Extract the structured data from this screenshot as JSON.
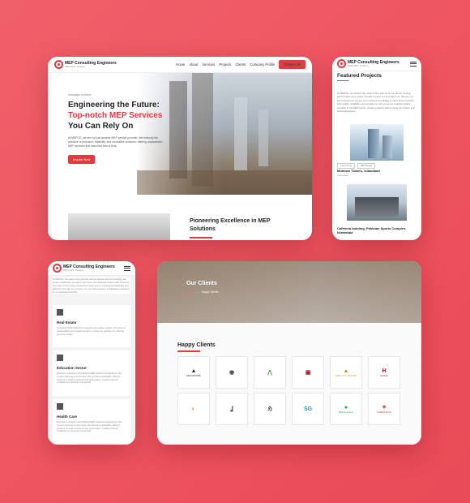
{
  "brand": {
    "name": "MEP Consulting Engineers",
    "tagline": "SMC-PVT. Limited",
    "accent": "#e53940"
  },
  "desktop": {
    "nav": [
      "Home",
      "About",
      "Services",
      "Projects",
      "Clients",
      "Company Profile"
    ],
    "cta": "Contact Us",
    "hero": {
      "kicker": "Innovation in Action",
      "h1_line1": "Engineering the Future:",
      "h1_line2": "Top-notch MEP Services",
      "h1_line3": "You Can Rely On",
      "body": "At MEPCE, we are not just another MEP service provider. We embody the pinnacle of precision, reliability, and innovative solutions; offering unparalleled MEP services that stand the test of time.",
      "button": "Inquire Now"
    },
    "section2_title": "Pioneering Excellence in MEP Solutions"
  },
  "featured": {
    "title": "Featured Projects",
    "body": "At MEPCE, we cherish the dreams and visions of our clients, finding each project as a unique canvas to paint our innovation on. We are not just contractors; we are your partners in building a future that resonates with quality, reliability, and excellence. Join us as we redefine what's possible in the MEP sector, creating spaces that embody innovation and technical finesse.",
    "tags": [
      "Commercial",
      "MEP Design"
    ],
    "projects": [
      {
        "name": "Midtown Towers, Islamabad",
        "sub": "Islamabad"
      },
      {
        "name": "Cafeteria building, Pakistan Sports Complex, Islamabad"
      }
    ]
  },
  "sectors": {
    "intro": "At MEPCE, we extend our expertise across various sectors including real estate, healthcare, education and more. Our dedicated team crafts solutions that cater to the unique demands of each sector, ensuring sustainability and efficiency through our services, be it a retail complex, a healthcare institution or an educational facility.",
    "items": [
      {
        "title": "Real Estate",
        "desc": "Innovative MEP solutions to elevate real estate projects, focusing on sustainability and modern design to create the epitome of a thriving property market."
      },
      {
        "title": "Education Sector",
        "desc": "Empower education with tailored MEP solutions designed for the modern learning environment. We provide sustainable, efficient systems to support schools and universities, creating optimal conditions for success and growth."
      },
      {
        "title": "Health Care",
        "desc": "Empower education with tailored MEP solutions designed for the modern learning environment. We provide sustainable, efficient systems to support schools and universities, creating optimal conditions for success and growth."
      }
    ]
  },
  "clients": {
    "hero_title": "Our Clients",
    "crumb_home": "Home",
    "crumb_sep": "→",
    "crumb_current": "Happy Clients",
    "section_title": "Happy Clients",
    "logos": [
      {
        "mark": "▲",
        "cap": "EMAARSONS",
        "color": "#2b2b2b"
      },
      {
        "mark": "◉",
        "cap": "",
        "color": "#444444"
      },
      {
        "mark": "⋀",
        "cap": "",
        "color": "#3aa03f"
      },
      {
        "mark": "▣",
        "cap": "",
        "color": "#b31e23"
      },
      {
        "mark": "▲",
        "cap": "NEW CITY ARCADE",
        "color": "#d18a1f"
      },
      {
        "mark": "H",
        "cap": "HONDA",
        "color": "#c8102e"
      },
      {
        "mark": "◐",
        "cap": "",
        "color": "#d8a33a"
      },
      {
        "mark": "ʆ",
        "cap": "",
        "color": "#222222"
      },
      {
        "mark": "ℌ",
        "cap": "",
        "color": "#333333"
      },
      {
        "mark": "SG",
        "cap": "",
        "color": "#2f8fb7"
      },
      {
        "mark": "●",
        "cap": "MEP Solutions",
        "color": "#2c9f57"
      },
      {
        "mark": "✶",
        "cap": "AHMED ZAKA",
        "color": "#c0392b"
      }
    ]
  }
}
